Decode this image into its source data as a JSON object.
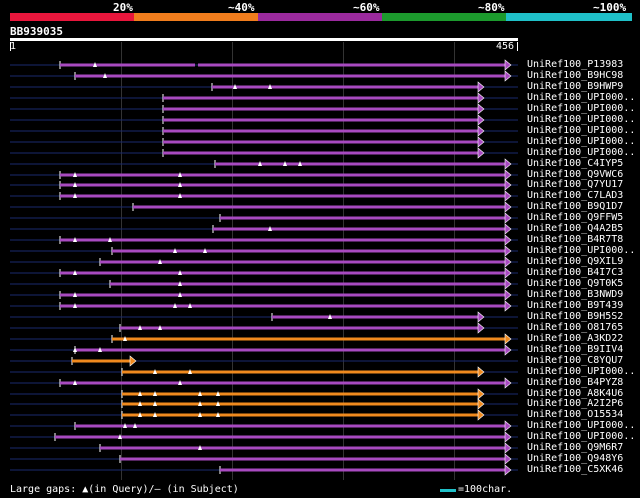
{
  "header": {
    "percent_labels": [
      "20%",
      "~40%",
      "~60%",
      "~80%",
      "~100%"
    ],
    "color_scale": [
      "#e8163c",
      "#f07d1d",
      "#9b2a9e",
      "#1c9a2d",
      "#1fc0c8"
    ]
  },
  "query": {
    "name": "BB939035",
    "start": "1",
    "end": "456",
    "length": 456
  },
  "colors": {
    "line": "#1a2a6e",
    "purple": "#a84ac0",
    "orange": "#f08a1e",
    "white": "#ffffff"
  },
  "hits": [
    {
      "label": "UniRef100_P13983",
      "color": "purple",
      "start": 60,
      "gaps": [
        [
          95,
          1
        ]
      ],
      "segs": [
        [
          60,
          195
        ],
        [
          198,
          505
        ]
      ],
      "wedges": [
        [
          95
        ]
      ]
    },
    {
      "label": "UniRef100_B9HC98",
      "color": "purple",
      "start": 75,
      "segs": [
        [
          75,
          505
        ]
      ],
      "wedges": [
        [
          105
        ]
      ]
    },
    {
      "label": "UniRef100_B9HWP9",
      "color": "purple",
      "start": 212,
      "segs": [
        [
          212,
          478
        ]
      ],
      "wedges": [
        [
          235
        ],
        [
          270
        ]
      ]
    },
    {
      "label": "UniRef100_UPI000..",
      "color": "purple",
      "start": 163,
      "segs": [
        [
          163,
          478
        ]
      ],
      "wedges": []
    },
    {
      "label": "UniRef100_UPI000..",
      "color": "purple",
      "start": 163,
      "segs": [
        [
          163,
          478
        ]
      ],
      "wedges": []
    },
    {
      "label": "UniRef100_UPI000..",
      "color": "purple",
      "start": 163,
      "segs": [
        [
          163,
          478
        ]
      ],
      "wedges": []
    },
    {
      "label": "UniRef100_UPI000..",
      "color": "purple",
      "start": 163,
      "segs": [
        [
          163,
          478
        ]
      ],
      "wedges": []
    },
    {
      "label": "UniRef100_UPI000..",
      "color": "purple",
      "start": 163,
      "segs": [
        [
          163,
          478
        ]
      ],
      "wedges": []
    },
    {
      "label": "UniRef100_UPI000..",
      "color": "purple",
      "start": 163,
      "segs": [
        [
          163,
          478
        ]
      ],
      "wedges": []
    },
    {
      "label": "UniRef100_C4IYP5",
      "color": "purple",
      "start": 215,
      "segs": [
        [
          215,
          505
        ]
      ],
      "wedges": [
        [
          260
        ],
        [
          285
        ],
        [
          300
        ]
      ]
    },
    {
      "label": "UniRef100_Q9VWC6",
      "color": "purple",
      "start": 60,
      "segs": [
        [
          60,
          505
        ]
      ],
      "wedges": [
        [
          75
        ],
        [
          180
        ]
      ]
    },
    {
      "label": "UniRef100_Q7YU17",
      "color": "purple",
      "start": 60,
      "segs": [
        [
          60,
          505
        ]
      ],
      "wedges": [
        [
          75
        ],
        [
          180
        ]
      ]
    },
    {
      "label": "UniRef100_C7LAD3",
      "color": "purple",
      "start": 60,
      "segs": [
        [
          60,
          505
        ]
      ],
      "wedges": [
        [
          75
        ],
        [
          180
        ]
      ]
    },
    {
      "label": "UniRef100_B9Q1D7",
      "color": "purple",
      "start": 133,
      "segs": [
        [
          133,
          505
        ]
      ],
      "wedges": []
    },
    {
      "label": "UniRef100_Q9FFW5",
      "color": "purple",
      "start": 220,
      "segs": [
        [
          220,
          505
        ]
      ],
      "wedges": []
    },
    {
      "label": "UniRef100_Q4A2B5",
      "color": "purple",
      "start": 213,
      "segs": [
        [
          213,
          505
        ]
      ],
      "wedges": [
        [
          270
        ]
      ]
    },
    {
      "label": "UniRef100_B4R7T8",
      "color": "purple",
      "start": 60,
      "segs": [
        [
          60,
          505
        ]
      ],
      "wedges": [
        [
          75
        ],
        [
          110
        ]
      ]
    },
    {
      "label": "UniRef100_UPI000..",
      "color": "purple",
      "start": 112,
      "segs": [
        [
          112,
          505
        ]
      ],
      "wedges": [
        [
          175
        ],
        [
          205
        ]
      ]
    },
    {
      "label": "UniRef100_Q9XIL9",
      "color": "purple",
      "start": 100,
      "segs": [
        [
          100,
          505
        ]
      ],
      "wedges": [
        [
          160
        ]
      ]
    },
    {
      "label": "UniRef100_B4I7C3",
      "color": "purple",
      "start": 60,
      "segs": [
        [
          60,
          505
        ]
      ],
      "wedges": [
        [
          75
        ],
        [
          180
        ]
      ]
    },
    {
      "label": "UniRef100_Q9T0K5",
      "color": "purple",
      "start": 110,
      "segs": [
        [
          110,
          505
        ]
      ],
      "wedges": [
        [
          180
        ]
      ]
    },
    {
      "label": "UniRef100_B3NWD9",
      "color": "purple",
      "start": 60,
      "segs": [
        [
          60,
          505
        ]
      ],
      "wedges": [
        [
          75
        ],
        [
          180
        ]
      ]
    },
    {
      "label": "UniRef100_B9T439",
      "color": "purple",
      "start": 60,
      "segs": [
        [
          60,
          505
        ]
      ],
      "wedges": [
        [
          75
        ],
        [
          175
        ],
        [
          190
        ]
      ]
    },
    {
      "label": "UniRef100_B9H5S2",
      "color": "purple",
      "start": 272,
      "segs": [
        [
          272,
          478
        ]
      ],
      "wedges": [
        [
          330
        ]
      ]
    },
    {
      "label": "UniRef100_O81765",
      "color": "purple",
      "start": 120,
      "segs": [
        [
          120,
          478
        ]
      ],
      "wedges": [
        [
          140
        ],
        [
          160
        ]
      ]
    },
    {
      "label": "UniRef100_A3KD22",
      "color": "orange",
      "start": 112,
      "segs": [
        [
          112,
          505
        ]
      ],
      "wedges": [
        [
          125
        ]
      ]
    },
    {
      "label": "UniRef100_B9IIV4",
      "color": "purple",
      "start": 75,
      "segs": [
        [
          75,
          505
        ]
      ],
      "wedges": [
        [
          75
        ],
        [
          100
        ]
      ]
    },
    {
      "label": "UniRef100_C8YQU7",
      "color": "orange",
      "start": 72,
      "segs": [
        [
          72,
          130
        ]
      ],
      "wedges": []
    },
    {
      "label": "UniRef100_UPI000..",
      "color": "orange",
      "start": 122,
      "segs": [
        [
          122,
          478
        ]
      ],
      "wedges": [
        [
          155
        ],
        [
          190
        ]
      ]
    },
    {
      "label": "UniRef100_B4PYZ8",
      "color": "purple",
      "start": 60,
      "segs": [
        [
          60,
          505
        ]
      ],
      "wedges": [
        [
          75
        ],
        [
          180
        ]
      ]
    },
    {
      "label": "UniRef100_A8K4U6",
      "color": "orange",
      "start": 122,
      "segs": [
        [
          122,
          478
        ]
      ],
      "wedges": [
        [
          140
        ],
        [
          155
        ],
        [
          200
        ],
        [
          218
        ]
      ]
    },
    {
      "label": "UniRef100_A2I2P6",
      "color": "orange",
      "start": 122,
      "segs": [
        [
          122,
          478
        ]
      ],
      "wedges": [
        [
          140
        ],
        [
          155
        ],
        [
          200
        ],
        [
          218
        ]
      ]
    },
    {
      "label": "UniRef100_O15534",
      "color": "orange",
      "start": 122,
      "segs": [
        [
          122,
          478
        ]
      ],
      "wedges": [
        [
          140
        ],
        [
          155
        ],
        [
          200
        ],
        [
          218
        ]
      ]
    },
    {
      "label": "UniRef100_UPI000..",
      "color": "purple",
      "start": 75,
      "segs": [
        [
          75,
          505
        ]
      ],
      "wedges": [
        [
          125
        ],
        [
          135
        ]
      ]
    },
    {
      "label": "UniRef100_UPI000..",
      "color": "purple",
      "start": 55,
      "segs": [
        [
          55,
          505
        ]
      ],
      "wedges": [
        [
          120
        ]
      ]
    },
    {
      "label": "UniRef100_Q9M6R7",
      "color": "purple",
      "start": 100,
      "segs": [
        [
          100,
          505
        ]
      ],
      "wedges": [
        [
          200
        ]
      ]
    },
    {
      "label": "UniRef100_Q948Y6",
      "color": "purple",
      "start": 120,
      "segs": [
        [
          120,
          505
        ]
      ],
      "wedges": []
    },
    {
      "label": "UniRef100_C5XK46",
      "color": "purple",
      "start": 220,
      "segs": [
        [
          220,
          505
        ]
      ],
      "wedges": []
    }
  ],
  "legend": {
    "gaps_text": "Large gaps: ▲(in Query)/– (in Subject)",
    "scale_text": "=100char."
  }
}
